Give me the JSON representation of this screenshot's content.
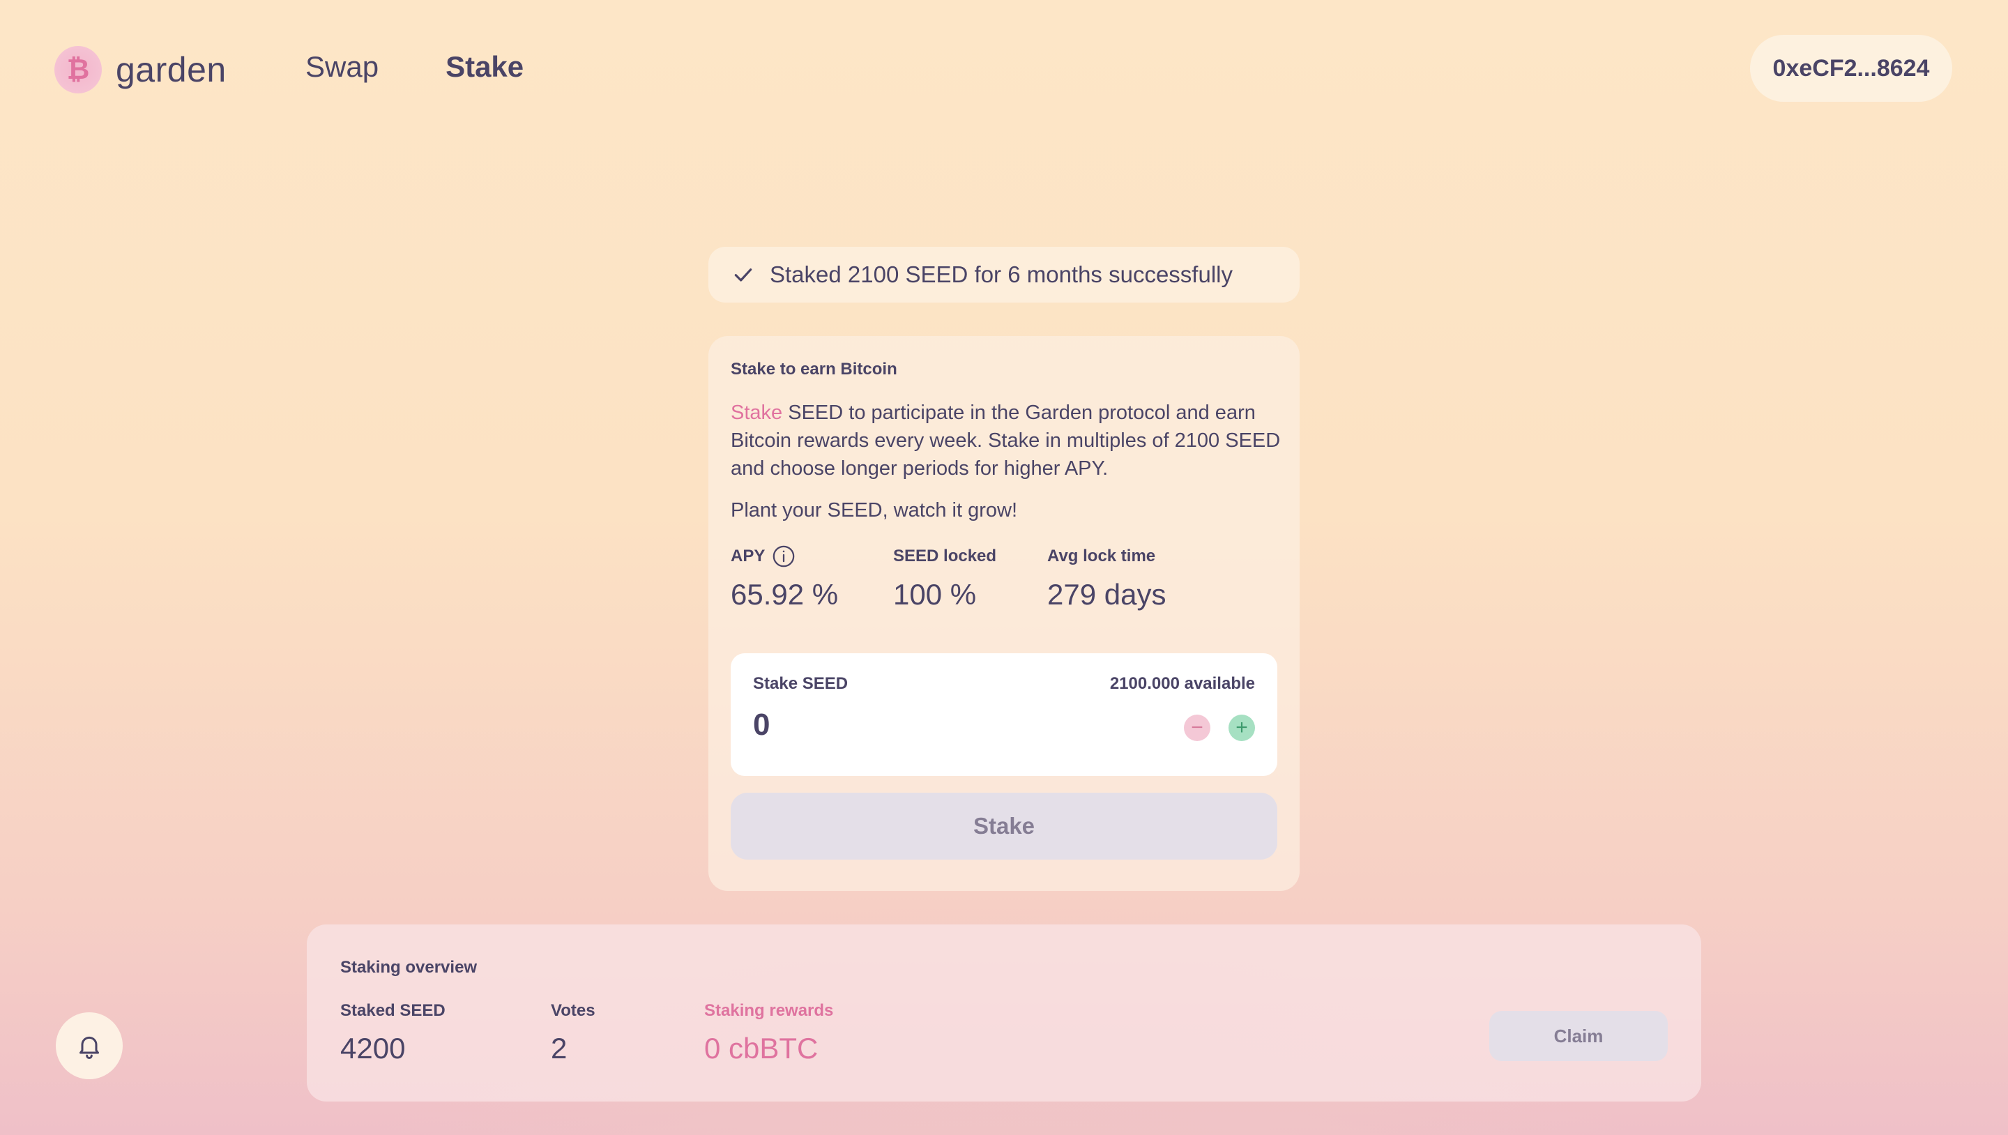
{
  "header": {
    "logo_text": "garden",
    "logo_glyph": "₿",
    "nav": [
      {
        "label": "Swap",
        "active": false
      },
      {
        "label": "Stake",
        "active": true
      }
    ],
    "wallet_address": "0xeCF2...8624"
  },
  "toast": {
    "message": "Staked 2100 SEED for 6 months successfully",
    "icon": "check-icon"
  },
  "stake_card": {
    "title": "Stake to earn Bitcoin",
    "desc_highlight": "Stake",
    "desc_rest": " SEED to participate in the Garden protocol and earn Bitcoin rewards every week. Stake in multiples of 2100 SEED and choose longer periods for higher APY.",
    "tagline": "Plant your SEED, watch it grow!",
    "stats": {
      "apy_label": "APY",
      "apy_value": "65.92 %",
      "locked_label": "SEED locked",
      "locked_value": "100 %",
      "lock_time_label": "Avg lock time",
      "lock_time_value": "279 days"
    },
    "input": {
      "label": "Stake SEED",
      "available": "2100.000 available",
      "value": "0",
      "minus": "−",
      "plus": "+"
    },
    "stake_button": "Stake"
  },
  "overview": {
    "title": "Staking overview",
    "staked_label": "Staked SEED",
    "staked_value": "4200",
    "votes_label": "Votes",
    "votes_value": "2",
    "rewards_label": "Staking rewards",
    "rewards_value": "0 cbBTC",
    "claim_button": "Claim"
  },
  "colors": {
    "accent_pink": "#df739f",
    "text": "#4a4466",
    "disabled_button": "#e4dfe8",
    "plus_green": "#a6e0c2"
  }
}
